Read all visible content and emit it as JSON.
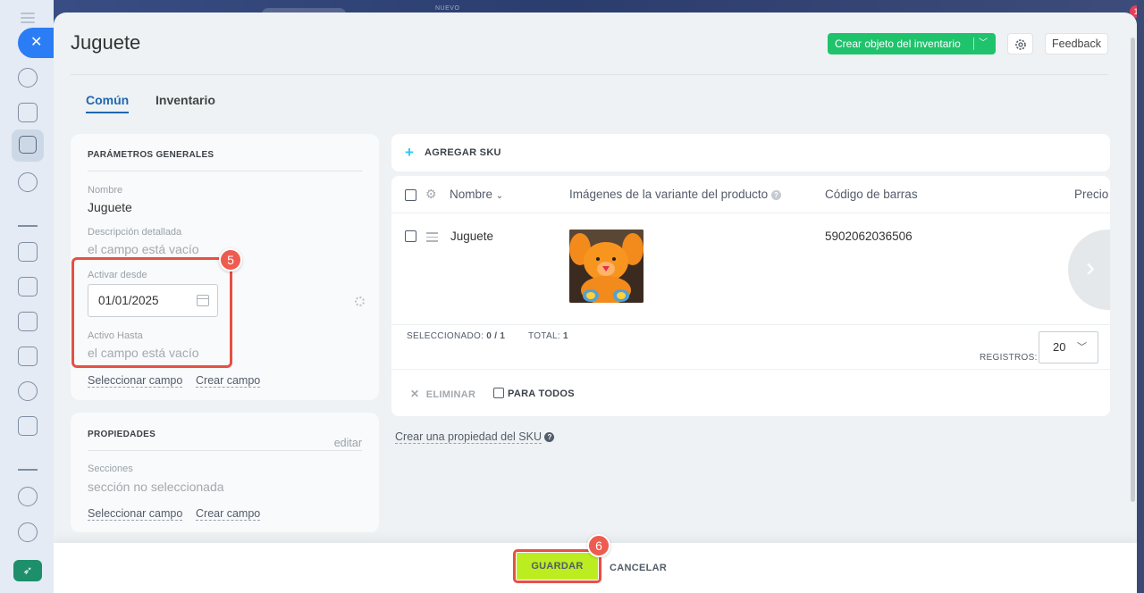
{
  "background": {
    "tag": "NUEVO",
    "notif_count": "1"
  },
  "header": {
    "title": "Juguete",
    "create_label": "Crear objeto del inventario",
    "feedback_label": "Feedback"
  },
  "tabs": [
    {
      "label": "Común"
    },
    {
      "label": "Inventario"
    }
  ],
  "general": {
    "title": "PARÁMETROS GENERALES",
    "name_label": "Nombre",
    "name_value": "Juguete",
    "desc_label": "Descripción detallada",
    "desc_value": "el campo está vacío",
    "active_from_label": "Activar desde",
    "active_from_value": "01/01/2025",
    "active_to_label": "Activo Hasta",
    "active_to_value": "el campo está vacío",
    "select_field": "Seleccionar campo",
    "create_field": "Crear campo"
  },
  "properties": {
    "title": "PROPIEDADES",
    "edit_label": "editar",
    "sections_label": "Secciones",
    "sections_value": "sección no seleccionada",
    "select_field": "Seleccionar campo",
    "create_field": "Crear campo"
  },
  "sku": {
    "add_label": "AGREGAR SKU",
    "columns": [
      "Nombre",
      "Imágenes de la variante del producto",
      "Código de barras",
      "Precio"
    ],
    "rows": [
      {
        "name": "Juguete",
        "barcode": "5902062036506"
      }
    ],
    "selected_label": "SELECCIONADO:",
    "selected_value": "0 / 1",
    "total_label": "TOTAL:",
    "total_value": "1",
    "records_label": "REGISTROS:",
    "records_value": "20",
    "delete_label": "ELIMINAR",
    "for_all_label": "PARA TODOS",
    "create_property": "Crear una propiedad del SKU"
  },
  "footer": {
    "save_label": "GUARDAR",
    "cancel_label": "CANCELAR"
  },
  "steps": {
    "step5": "5",
    "step6": "6"
  },
  "colors": {
    "accent_green": "#1fc36b",
    "save_green": "#bbed21",
    "highlight_red": "#e65044",
    "link_blue": "#2067b0"
  }
}
